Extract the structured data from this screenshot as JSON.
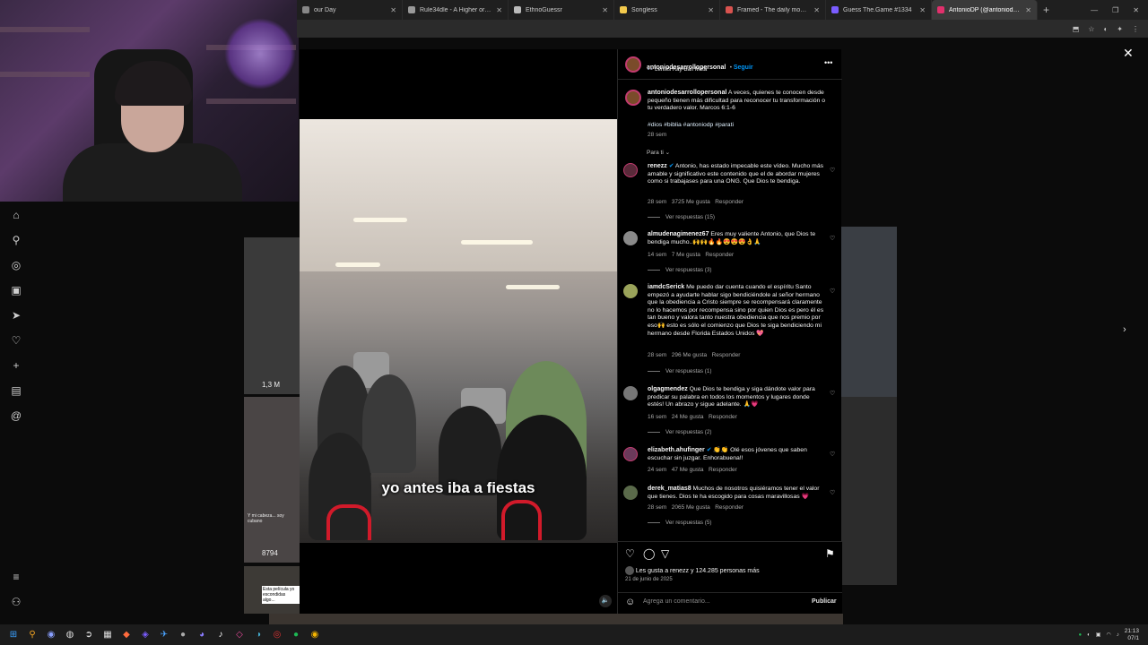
{
  "browser": {
    "tabs": [
      {
        "title": "our Day",
        "color": "#888888"
      },
      {
        "title": "Rule34dle - A Higher or Lower",
        "color": "#999999"
      },
      {
        "title": "EthnoGuessr",
        "color": "#bbbbbb"
      },
      {
        "title": "Songless",
        "color": "#f2c94c"
      },
      {
        "title": "Framed - The daily movie guess",
        "color": "#d9534f"
      },
      {
        "title": "Guess The.Game #1334",
        "color": "#7a5cff"
      },
      {
        "title": "AntonioDP (@antoniodesarrollo",
        "color": "#e1306c",
        "active": true
      }
    ],
    "new_tab": "+",
    "controls": [
      "—",
      "❐",
      "✕"
    ]
  },
  "post": {
    "author": "antoniodesarrollopersonal",
    "follow": "Seguir",
    "subtitle": "Lentes Ray-Ban Meta",
    "caption_text": "A veces, quienes te conocen desde pequeño tienen más dificultad para reconocer tu transformación o tu verdadero valor. Marcos 6:1-6",
    "hashtags": "#dios #biblia #antoniodp #parati",
    "caption_time": "28 sem",
    "filter": "Para ti",
    "video_caption": "yo antes iba a fiestas",
    "likes": "Les gusta a renezz y 124.285 personas más",
    "date": "21 de junio de 2025",
    "comment_placeholder": "Agrega un comentario...",
    "publish": "Publicar"
  },
  "comments": [
    {
      "user": "renezz",
      "verified": true,
      "text": "Antonio, has estado impecable este vídeo. Mucho más amable y significativo este contenido que el de abordar mujeres como si trabajases para una ONG. Que Dios te bendiga.",
      "time": "28 sem",
      "likes": "3725 Me gusta",
      "reply": "Responder",
      "replies": "Ver respuestas (15)",
      "color": "#5a2a3a"
    },
    {
      "user": "almudenagimenez67",
      "verified": false,
      "text": "Eres muy valiente Antonio, que Dios te bendiga mucho..🙌🙌🔥🔥😍😍😍👌🙏",
      "time": "14 sem",
      "likes": "7 Me gusta",
      "reply": "Responder",
      "replies": "Ver respuestas (3)",
      "color": "#8a8a8a"
    },
    {
      "user": "iamdcSerick",
      "verified": false,
      "text": "Me puedo dar cuenta cuando el espíritu Santo empezó a ayudarte hablar sigo bendiciéndole al señor hermano que la obediencia a Cristo siempre se recompensará claramente no lo hacemos por recompensa sino por quien Dios es pero él es tan bueno y valora tanto nuestra obediencia que nos premio por eso🙌 esto es sólo el comienzo que Dios te siga bendiciendo mi hermano desde Florida Estados Unidos 💖",
      "time": "28 sem",
      "likes": "296 Me gusta",
      "reply": "Responder",
      "replies": "Ver respuestas (1)",
      "color": "#9aa35a"
    },
    {
      "user": "olgagmendez",
      "verified": false,
      "text": "Que Dios te bendiga y siga dándote valor para predicar su palabra en todos los momentos y lugares donde estés! Un abrazo y sigue adelante. 🙏💗",
      "time": "16 sem",
      "likes": "24 Me gusta",
      "reply": "Responder",
      "replies": "Ver respuestas (2)",
      "color": "#777777"
    },
    {
      "user": "elizabeth.ahufinger",
      "verified": true,
      "text": "👏👏 Olé esos jóvenes que saben escuchar sin juzgar. Enhorabuena!!",
      "time": "24 sem",
      "likes": "47 Me gusta",
      "reply": "Responder",
      "replies": "",
      "color": "#6a3a5a"
    },
    {
      "user": "derek_matias8",
      "verified": false,
      "text": "Muchos de nosotros quisiéramos tener el valor que tienes. Dios te ha escogido para cosas maravillosas 💗",
      "time": "28 sem",
      "likes": "2065 Me gusta",
      "reply": "Responder",
      "replies": "Ver respuestas (5)",
      "color": "#5a6a4a"
    }
  ],
  "background": {
    "views_a": "1,3 M",
    "views_b": "8794",
    "overlay_a": "Esta película yo escondidas algo...",
    "overlay_b": "Y mi cabeza... soy cubano"
  },
  "taskbar": {
    "time": "21:13",
    "date": "07/1"
  },
  "colors": {
    "accent": "#0095f6",
    "bg": "#000000",
    "muted": "#a8a8a8"
  }
}
